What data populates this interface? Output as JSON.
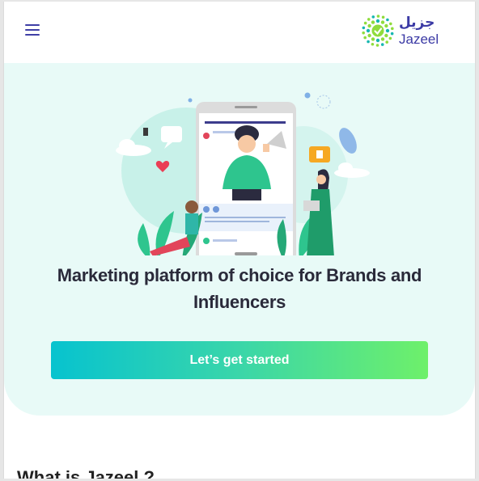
{
  "header": {
    "menu_icon": "hamburger-menu-icon",
    "logo": {
      "arabic": "جزيل",
      "english": "Jazeel"
    }
  },
  "hero": {
    "headline": "Marketing platform of choice for Brands and Influencers",
    "cta_label": "Let’s get started"
  },
  "section": {
    "title": "What is Jazeel ?"
  },
  "colors": {
    "brand_purple": "#3b3aa5",
    "hero_background": "#e8faf7",
    "cta_gradient_start": "#07c3cf",
    "cta_gradient_end": "#6ef06a"
  }
}
